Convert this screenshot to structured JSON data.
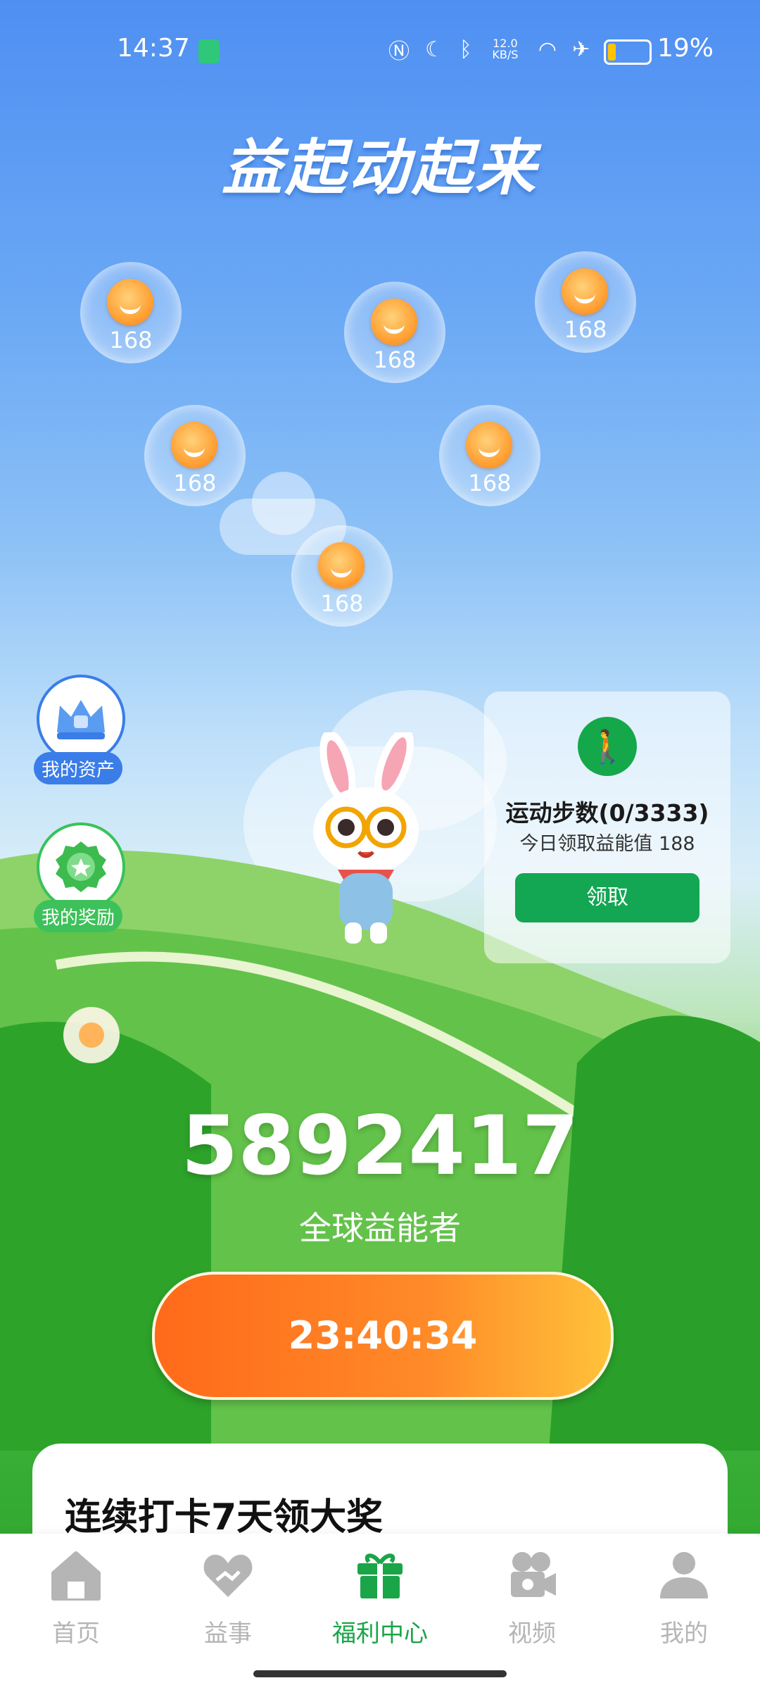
{
  "status_bar": {
    "time": "14:37",
    "network_speed": "12.0 KB/S",
    "battery": "19%",
    "battery_level": 0.19
  },
  "header": {
    "title": "益起动起来"
  },
  "bubbles": [
    {
      "value": "168"
    },
    {
      "value": "168"
    },
    {
      "value": "168"
    },
    {
      "value": "168"
    },
    {
      "value": "168"
    },
    {
      "value": "168"
    }
  ],
  "side": {
    "assets_label": "我的资产",
    "rewards_label": "我的奖励"
  },
  "steps_card": {
    "title": "运动步数(0/3333)",
    "subtitle": "今日领取益能值 188",
    "button_label": "领取"
  },
  "stats": {
    "count": "5892417",
    "count_label": "全球益能者",
    "timer": "23:40:34"
  },
  "checkin": {
    "title": "连续打卡7天领大奖"
  },
  "nav": {
    "items": [
      {
        "label": "首页",
        "icon": "home-icon"
      },
      {
        "label": "益事",
        "icon": "heart-hand-icon"
      },
      {
        "label": "福利中心",
        "icon": "gift-icon"
      },
      {
        "label": "视频",
        "icon": "video-camera-icon"
      },
      {
        "label": "我的",
        "icon": "person-icon"
      }
    ],
    "active_color": "#1aa548",
    "inactive_color": "#b5b5b5"
  }
}
